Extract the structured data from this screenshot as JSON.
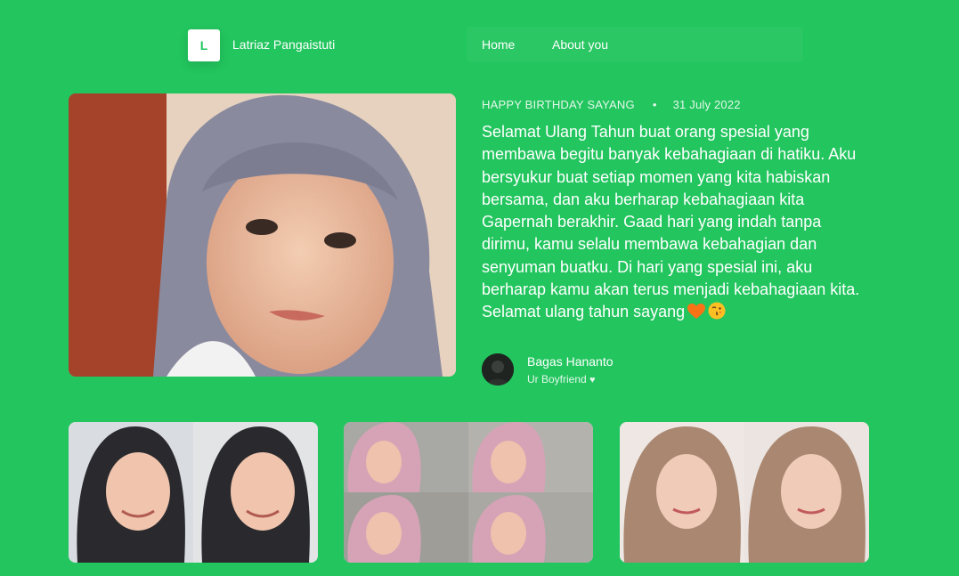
{
  "header": {
    "logo_letter": "L",
    "brand_name": "Latriaz Pangaistuti",
    "nav": [
      {
        "label": "Home"
      },
      {
        "label": "About you"
      }
    ]
  },
  "post": {
    "category": "HAPPY BIRTHDAY SAYANG",
    "separator": "•",
    "date": "31 July 2022",
    "message": "Selamat Ulang Tahun buat orang spesial yang membawa begitu banyak kebahagiaan di hatiku. Aku bersyukur buat setiap momen yang kita habiskan bersama, dan aku berharap kebahagiaan kita Gapernah berakhir. Gaad hari yang indah tanpa dirimu, kamu selalu membawa kebahagian dan senyuman buatku. Di hari yang spesial ini, aku berharap kamu akan terus menjadi kebahagiaan kita. Selamat ulang tahun sayang",
    "message_emojis": [
      "orange-heart-icon",
      "face-blowing-kiss-icon"
    ],
    "author": {
      "name": "Bagas Hananto",
      "role": "Ur Boyfriend",
      "role_icon": "white-heart-icon"
    }
  },
  "gallery": {
    "items": [
      {
        "name": "gallery-photo-1"
      },
      {
        "name": "gallery-photo-2"
      },
      {
        "name": "gallery-photo-3"
      }
    ]
  },
  "colors": {
    "background": "#22c55e",
    "text": "#ffffff",
    "logo_text": "#22c55e"
  }
}
